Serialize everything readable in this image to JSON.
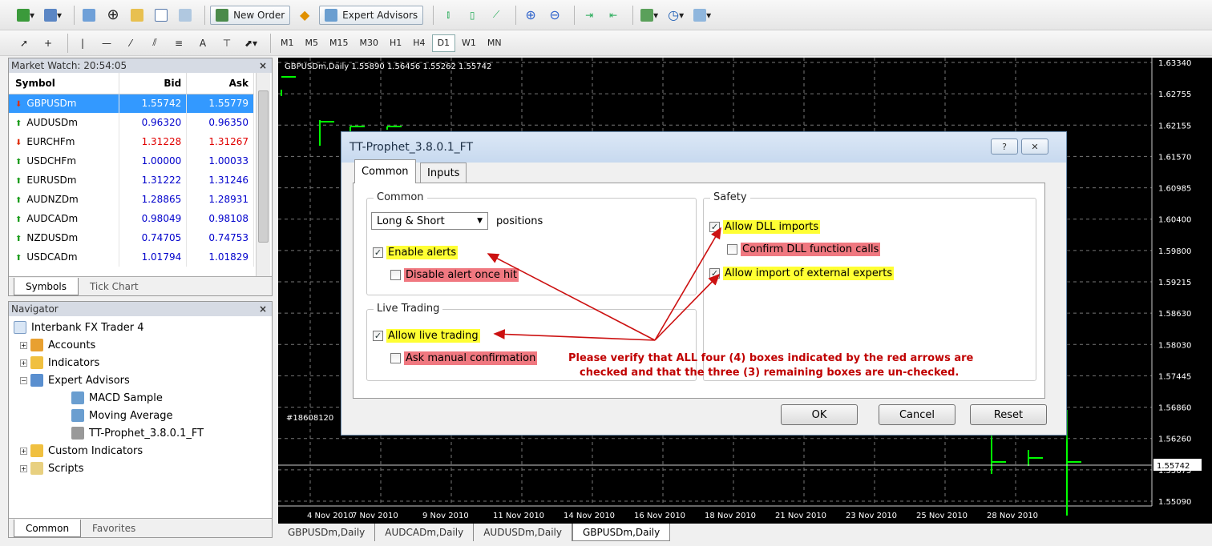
{
  "toolbar": {
    "new_order": "New Order",
    "expert_advisors": "Expert Advisors",
    "text_tool": "A",
    "timeframes": [
      "M1",
      "M5",
      "M15",
      "M30",
      "H1",
      "H4",
      "D1",
      "W1",
      "MN"
    ],
    "selected_timeframe": "D1"
  },
  "market_watch": {
    "title": "Market Watch: 20:54:05",
    "close": "×",
    "columns": [
      "Symbol",
      "Bid",
      "Ask"
    ],
    "rows": [
      {
        "symbol": "GBPUSDm",
        "bid": "1.55742",
        "ask": "1.55779",
        "dir": "down"
      },
      {
        "symbol": "AUDUSDm",
        "bid": "0.96320",
        "ask": "0.96350",
        "dir": "up"
      },
      {
        "symbol": "EURCHFm",
        "bid": "1.31228",
        "ask": "1.31267",
        "dir": "down"
      },
      {
        "symbol": "USDCHFm",
        "bid": "1.00000",
        "ask": "1.00033",
        "dir": "up"
      },
      {
        "symbol": "EURUSDm",
        "bid": "1.31222",
        "ask": "1.31246",
        "dir": "up"
      },
      {
        "symbol": "AUDNZDm",
        "bid": "1.28865",
        "ask": "1.28931",
        "dir": "up"
      },
      {
        "symbol": "AUDCADm",
        "bid": "0.98049",
        "ask": "0.98108",
        "dir": "up"
      },
      {
        "symbol": "NZDUSDm",
        "bid": "0.74705",
        "ask": "0.74753",
        "dir": "up"
      },
      {
        "symbol": "USDCADm",
        "bid": "1.01794",
        "ask": "1.01829",
        "dir": "up"
      }
    ],
    "tabs": [
      "Symbols",
      "Tick Chart"
    ]
  },
  "navigator": {
    "title": "Navigator",
    "close": "×",
    "root": "Interbank FX Trader 4",
    "accounts": "Accounts",
    "indicators": "Indicators",
    "expert_advisors": "Expert Advisors",
    "ea_items": [
      "MACD Sample",
      "Moving Average",
      "TT-Prophet_3.8.0.1_FT"
    ],
    "custom_indicators": "Custom Indicators",
    "scripts": "Scripts",
    "tabs": [
      "Common",
      "Favorites"
    ]
  },
  "chart": {
    "title": "GBPUSDm,Daily  1.55890 1.56456 1.55262 1.55742",
    "order_id": "#18608120",
    "price_labels": [
      "1.63340",
      "1.62755",
      "1.62155",
      "1.61570",
      "1.60985",
      "1.60400",
      "1.59800",
      "1.59215",
      "1.58630",
      "1.58030",
      "1.57445",
      "1.56860",
      "1.56260",
      "1.55675",
      "1.55090"
    ],
    "current_price": "1.55742",
    "date_labels": [
      "4 Nov 2010",
      "7 Nov 2010",
      "9 Nov 2010",
      "11 Nov 2010",
      "14 Nov 2010",
      "16 Nov 2010",
      "18 Nov 2010",
      "21 Nov 2010",
      "23 Nov 2010",
      "25 Nov 2010",
      "28 Nov 2010"
    ],
    "tabs": [
      "GBPUSDm,Daily",
      "AUDCADm,Daily",
      "AUDUSDm,Daily",
      "GBPUSDm,Daily"
    ]
  },
  "dialog": {
    "title": "TT-Prophet_3.8.0.1_FT",
    "help_btn": "?",
    "close_btn": "✕",
    "tabs": [
      "Common",
      "Inputs"
    ],
    "common_group": "Common",
    "positions_select": "Long & Short",
    "positions_label": "positions",
    "enable_alerts": "Enable alerts",
    "disable_alert_once_hit": "Disable alert once hit",
    "live_trading_group": "Live Trading",
    "allow_live_trading": "Allow live trading",
    "ask_manual_confirmation": "Ask manual confirmation",
    "safety_group": "Safety",
    "allow_dll_imports": "Allow DLL imports",
    "confirm_dll_calls": "Confirm DLL function calls",
    "allow_external_experts": "Allow import of external experts",
    "note_line1": "Please verify that ALL four (4) boxes indicated by the red arrows are",
    "note_line2": "checked and that the three (3) remaining boxes are un-checked.",
    "ok": "OK",
    "cancel": "Cancel",
    "reset": "Reset",
    "check_glyph": "✓"
  }
}
